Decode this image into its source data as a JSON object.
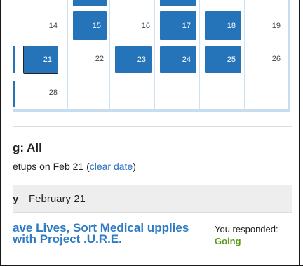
{
  "calendar": {
    "days_row1": [
      "14",
      "15",
      "16",
      "17",
      "18",
      "19"
    ],
    "days_row2": [
      "21",
      "22",
      "23",
      "24",
      "25",
      "26"
    ],
    "days_row3": [
      "28"
    ]
  },
  "filter": {
    "title": "g: All",
    "meetups_prefix": "etups on Feb 21",
    "clear_link": "clear date"
  },
  "date_header": {
    "weekday_fragment": "y",
    "date": "February 21"
  },
  "event": {
    "title": "ave Lives, Sort Medical upplies with Project .U.R.E.",
    "rsvp_label": "You responded:",
    "rsvp_status": "Going"
  },
  "colors": {
    "accent": "#2573b8",
    "link": "#2d6ec0",
    "going": "#5b9b1f"
  }
}
